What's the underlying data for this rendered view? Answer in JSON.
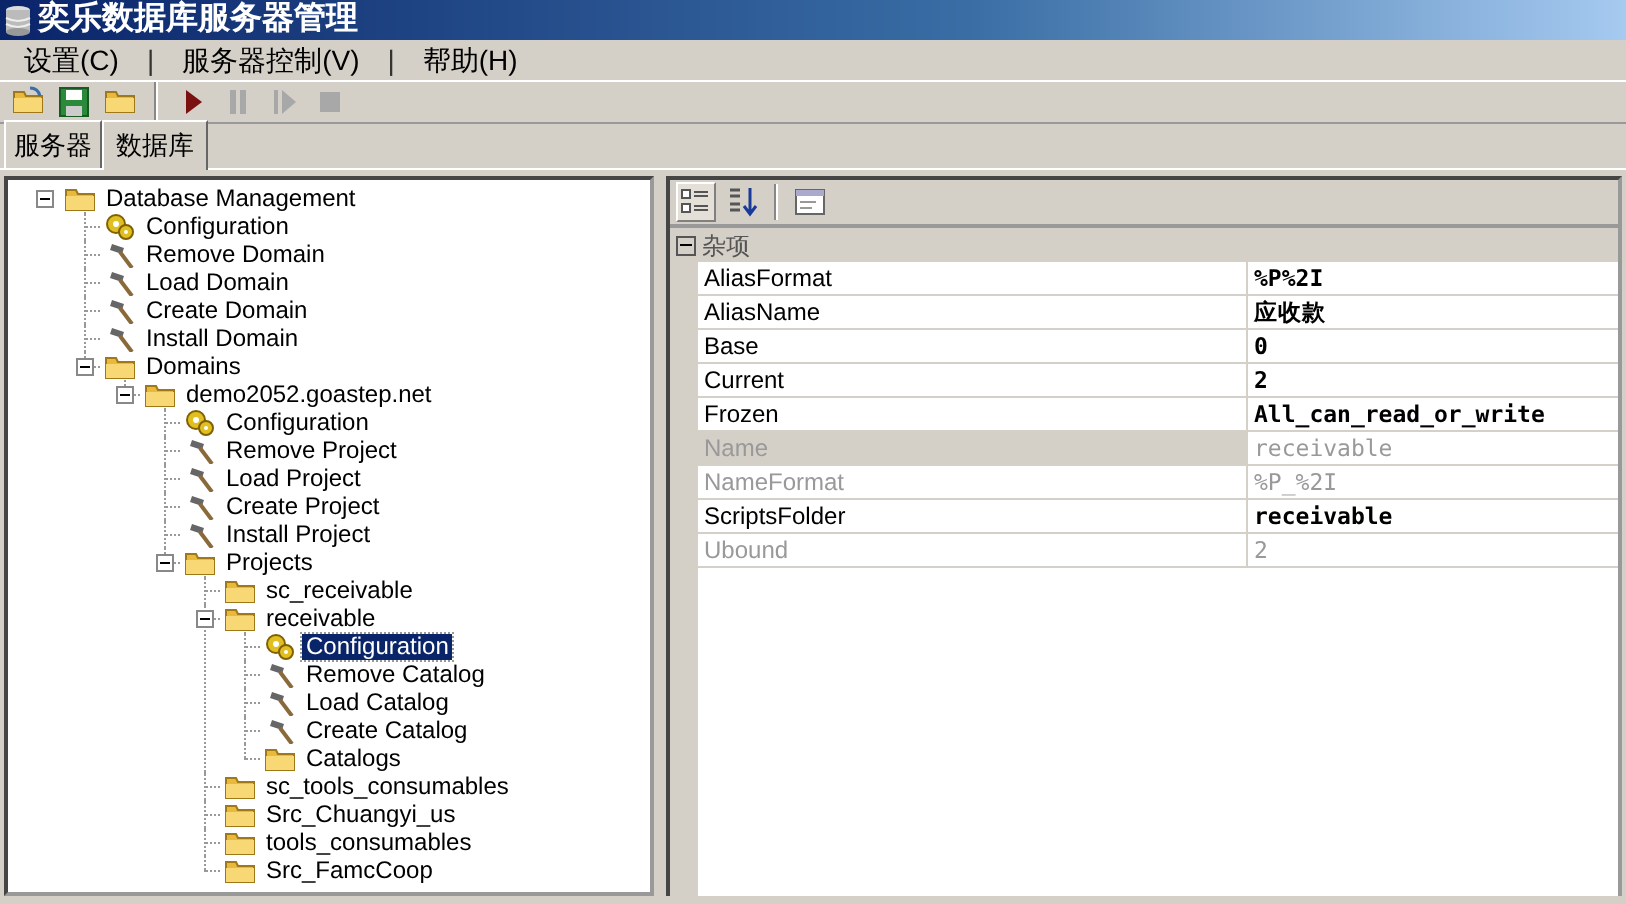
{
  "window": {
    "title": "奕乐数据库服务器管理"
  },
  "menu": [
    {
      "label": "设置(C)",
      "kind": "item"
    },
    {
      "label": "|",
      "kind": "separator"
    },
    {
      "label": "服务器控制(V)",
      "kind": "item"
    },
    {
      "label": "|",
      "kind": "separator"
    },
    {
      "label": "帮助(H)",
      "kind": "item"
    }
  ],
  "toolbar": [
    {
      "kind": "open",
      "disabled": false
    },
    {
      "kind": "save",
      "disabled": false
    },
    {
      "kind": "folder",
      "disabled": false
    },
    {
      "kind": "separator"
    },
    {
      "kind": "play",
      "disabled": false
    },
    {
      "kind": "pause",
      "disabled": true
    },
    {
      "kind": "step",
      "disabled": true
    },
    {
      "kind": "stop",
      "disabled": true
    }
  ],
  "tabs": [
    {
      "label": "服务器",
      "selected": false
    },
    {
      "label": "数据库",
      "selected": true
    }
  ],
  "tree": [
    {
      "label": "Database Management",
      "kind": "folder",
      "expanded": true,
      "selected": false,
      "children": [
        {
          "label": "Configuration",
          "kind": "gear",
          "selected": false
        },
        {
          "label": "Remove Domain",
          "kind": "tool",
          "selected": false
        },
        {
          "label": "Load Domain",
          "kind": "tool",
          "selected": false
        },
        {
          "label": "Create Domain",
          "kind": "tool",
          "selected": false
        },
        {
          "label": "Install Domain",
          "kind": "tool",
          "selected": false
        },
        {
          "label": "Domains",
          "kind": "folder",
          "expanded": true,
          "selected": false,
          "children": [
            {
              "label": "demo2052.goastep.net",
              "kind": "folder",
              "expanded": true,
              "selected": false,
              "children": [
                {
                  "label": "Configuration",
                  "kind": "gear",
                  "selected": false
                },
                {
                  "label": "Remove Project",
                  "kind": "tool",
                  "selected": false
                },
                {
                  "label": "Load Project",
                  "kind": "tool",
                  "selected": false
                },
                {
                  "label": "Create Project",
                  "kind": "tool",
                  "selected": false
                },
                {
                  "label": "Install Project",
                  "kind": "tool",
                  "selected": false
                },
                {
                  "label": "Projects",
                  "kind": "folder",
                  "expanded": true,
                  "selected": false,
                  "children": [
                    {
                      "label": "sc_receivable",
                      "kind": "folder",
                      "selected": false
                    },
                    {
                      "label": "receivable",
                      "kind": "folder",
                      "expanded": true,
                      "selected": false,
                      "children": [
                        {
                          "label": "Configuration",
                          "kind": "gear",
                          "selected": true
                        },
                        {
                          "label": "Remove Catalog",
                          "kind": "tool",
                          "selected": false
                        },
                        {
                          "label": "Load Catalog",
                          "kind": "tool",
                          "selected": false
                        },
                        {
                          "label": "Create Catalog",
                          "kind": "tool",
                          "selected": false
                        },
                        {
                          "label": "Catalogs",
                          "kind": "folder",
                          "selected": false
                        }
                      ]
                    },
                    {
                      "label": "sc_tools_consumables",
                      "kind": "folder",
                      "selected": false
                    },
                    {
                      "label": "Src_Chuangyi_us",
                      "kind": "folder",
                      "selected": false
                    },
                    {
                      "label": "tools_consumables",
                      "kind": "folder",
                      "selected": false
                    },
                    {
                      "label": "Src_FamcCoop",
                      "kind": "folder",
                      "selected": false
                    }
                  ]
                }
              ]
            }
          ]
        }
      ]
    }
  ],
  "property_toolbar": [
    {
      "kind": "categorized",
      "selected": true
    },
    {
      "kind": "alphabetical",
      "selected": false
    },
    {
      "kind": "separator"
    },
    {
      "kind": "pages",
      "selected": false
    }
  ],
  "property_grid": {
    "category": {
      "label": "杂项",
      "expanded": true
    },
    "rows": [
      {
        "name": "AliasFormat",
        "value": "%P%2I",
        "disabled": false,
        "selected": false
      },
      {
        "name": "AliasName",
        "value": "应收款",
        "disabled": false,
        "selected": false
      },
      {
        "name": "Base",
        "value": "0",
        "disabled": false,
        "selected": false
      },
      {
        "name": "Current",
        "value": "2",
        "disabled": false,
        "selected": false
      },
      {
        "name": "Frozen",
        "value": "All_can_read_or_write",
        "disabled": false,
        "selected": false
      },
      {
        "name": "Name",
        "value": "receivable",
        "disabled": true,
        "selected": true
      },
      {
        "name": "NameFormat",
        "value": "%P_%2I",
        "disabled": true,
        "selected": false
      },
      {
        "name": "ScriptsFolder",
        "value": "receivable",
        "disabled": false,
        "selected": false
      },
      {
        "name": "Ubound",
        "value": "2",
        "disabled": true,
        "selected": false
      }
    ]
  }
}
